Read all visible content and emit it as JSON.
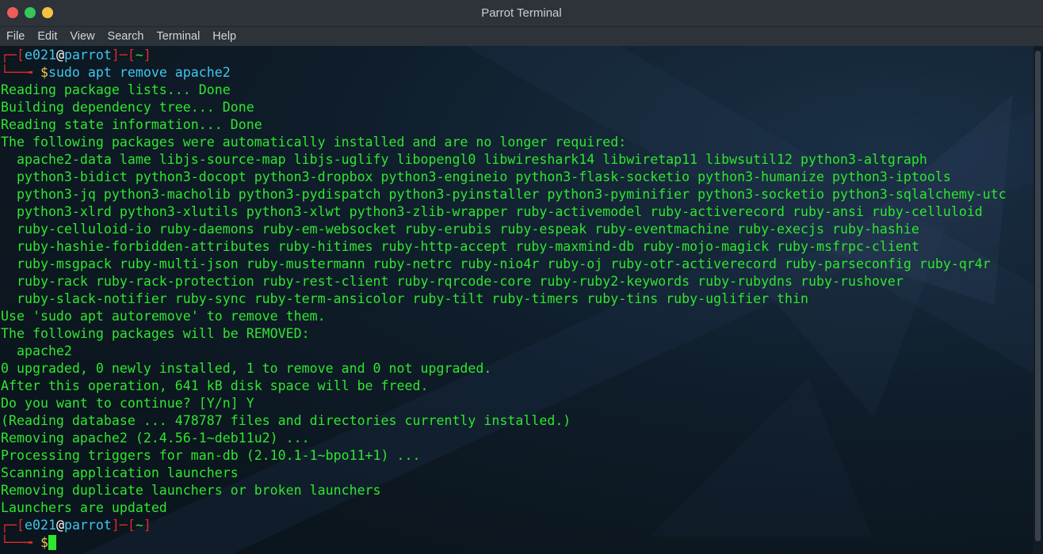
{
  "window": {
    "title": "Parrot Terminal",
    "controls": {
      "close_color": "#ef5b5b",
      "maximize_color": "#35c759",
      "minimize_color": "#f5c242"
    }
  },
  "menu": {
    "items": [
      "File",
      "Edit",
      "View",
      "Search",
      "Terminal",
      "Help"
    ]
  },
  "prompt": {
    "top_left": "┌─[",
    "user": "e021",
    "at": "@",
    "host": "parrot",
    "mid": "]─[",
    "cwd": "~",
    "close": "]",
    "bottom_left": "└──╼ ",
    "symbol": "$"
  },
  "session": {
    "command": "sudo apt remove apache2",
    "output": [
      "Reading package lists... Done",
      "Building dependency tree... Done",
      "Reading state information... Done",
      "The following packages were automatically installed and are no longer required:",
      "  apache2-data lame libjs-source-map libjs-uglify libopengl0 libwireshark14 libwiretap11 libwsutil12 python3-altgraph",
      "  python3-bidict python3-docopt python3-dropbox python3-engineio python3-flask-socketio python3-humanize python3-iptools",
      "  python3-jq python3-macholib python3-pydispatch python3-pyinstaller python3-pyminifier python3-socketio python3-sqlalchemy-utc",
      "  python3-xlrd python3-xlutils python3-xlwt python3-zlib-wrapper ruby-activemodel ruby-activerecord ruby-ansi ruby-celluloid",
      "  ruby-celluloid-io ruby-daemons ruby-em-websocket ruby-erubis ruby-espeak ruby-eventmachine ruby-execjs ruby-hashie",
      "  ruby-hashie-forbidden-attributes ruby-hitimes ruby-http-accept ruby-maxmind-db ruby-mojo-magick ruby-msfrpc-client",
      "  ruby-msgpack ruby-multi-json ruby-mustermann ruby-netrc ruby-nio4r ruby-oj ruby-otr-activerecord ruby-parseconfig ruby-qr4r",
      "  ruby-rack ruby-rack-protection ruby-rest-client ruby-rqrcode-core ruby-ruby2-keywords ruby-rubydns ruby-rushover",
      "  ruby-slack-notifier ruby-sync ruby-term-ansicolor ruby-tilt ruby-timers ruby-tins ruby-uglifier thin",
      "Use 'sudo apt autoremove' to remove them.",
      "The following packages will be REMOVED:",
      "  apache2",
      "0 upgraded, 0 newly installed, 1 to remove and 0 not upgraded.",
      "After this operation, 641 kB disk space will be freed.",
      "Do you want to continue? [Y/n] Y",
      "(Reading database ... 478787 files and directories currently installed.)",
      "Removing apache2 (2.4.56-1~deb11u2) ...",
      "Processing triggers for man-db (2.10.1-1~bpo11+1) ...",
      "Scanning application launchers",
      "Removing duplicate launchers or broken launchers",
      "Launchers are updated"
    ]
  },
  "colors": {
    "output_text": "#2fe62f",
    "prompt_bracket": "#e02a2a",
    "prompt_user": "#3fc6ee",
    "prompt_symbol": "#f2c744"
  }
}
